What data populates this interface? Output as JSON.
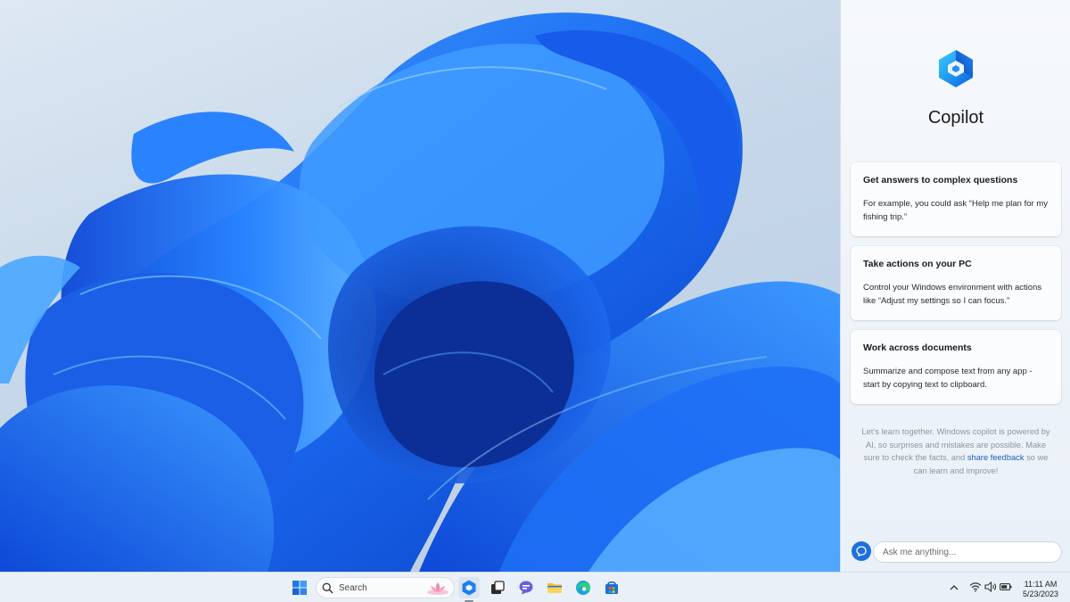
{
  "copilot": {
    "title": "Copilot",
    "cards": [
      {
        "title": "Get answers to complex questions",
        "body": "For example, you could ask “Help me plan for my fishing trip.”"
      },
      {
        "title": "Take actions on your PC",
        "body": "Control your Windows environment with actions like “Adjust my settings so I can focus.”"
      },
      {
        "title": "Work across documents",
        "body": "Summarize and compose text from any app - start by copying text to clipboard."
      }
    ],
    "disclaimer_pre": "Let’s learn together. Windows copilot is powered by AI, so surprises and mistakes are possible. Make sure to check the facts, and ",
    "disclaimer_link": "share feedback",
    "disclaimer_post": " so we can learn and improve!",
    "input_placeholder": "Ask me anything..."
  },
  "taskbar": {
    "search_label": "Search",
    "icons": [
      "windows-start-icon",
      "copilot-icon",
      "task-view-icon",
      "teams-chat-icon",
      "file-explorer-icon",
      "edge-icon",
      "store-icon"
    ],
    "tray_icons": [
      "chevron-up-icon",
      "wifi-icon",
      "volume-icon",
      "battery-icon"
    ],
    "time": "11:11 AM",
    "date": "5/23/2023"
  },
  "colors": {
    "accent": "#1f6fe0",
    "wallpaper_blue": "#1a5fe6",
    "panel_bg": "#f2f6fb",
    "link": "#1d62b5"
  }
}
